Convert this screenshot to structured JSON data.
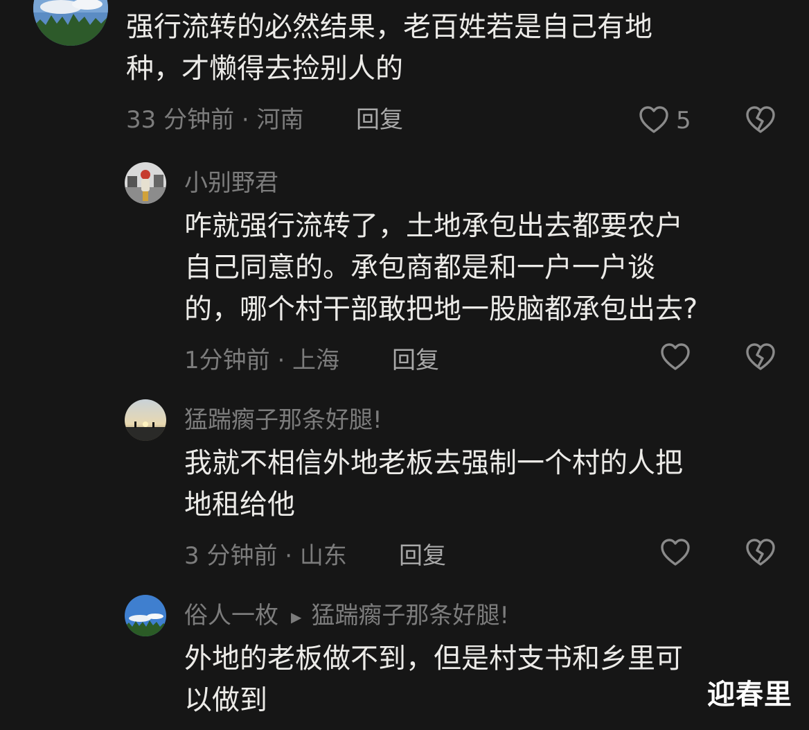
{
  "comments": [
    {
      "username": "",
      "lines": [
        "强行流转的必然结果，老百姓若是自己有地",
        "种，才懒得去捡别人的"
      ],
      "time_location": "33 分钟前 · 河南",
      "reply_label": "回复",
      "like_count": "5"
    },
    {
      "username": "小别野君",
      "lines": [
        "咋就强行流转了，土地承包出去都要农户",
        "自己同意的。承包商都是和一户一户谈",
        "的，哪个村干部敢把地一股脑都承包出去?"
      ],
      "time_location": "1分钟前 · 上海",
      "reply_label": "回复",
      "like_count": ""
    },
    {
      "username": "猛踹瘸子那条好腿!",
      "lines": [
        "我就不相信外地老板去强制一个村的人把",
        "地租给他"
      ],
      "time_location": "3 分钟前 · 山东",
      "reply_label": "回复",
      "like_count": ""
    },
    {
      "username": "俗人一枚",
      "reply_to": "猛踹瘸子那条好腿!",
      "lines": [
        "外地的老板做不到，但是村支书和乡里可",
        "以做到"
      ]
    }
  ],
  "watermark": "迎春里",
  "icons": {
    "like": "heart-outline-icon",
    "dislike": "broken-heart-icon",
    "reply_arrow": "triangle-right-icon"
  },
  "colors": {
    "background": "#161616",
    "text": "#ecebe8",
    "meta": "#7c7c7c"
  }
}
